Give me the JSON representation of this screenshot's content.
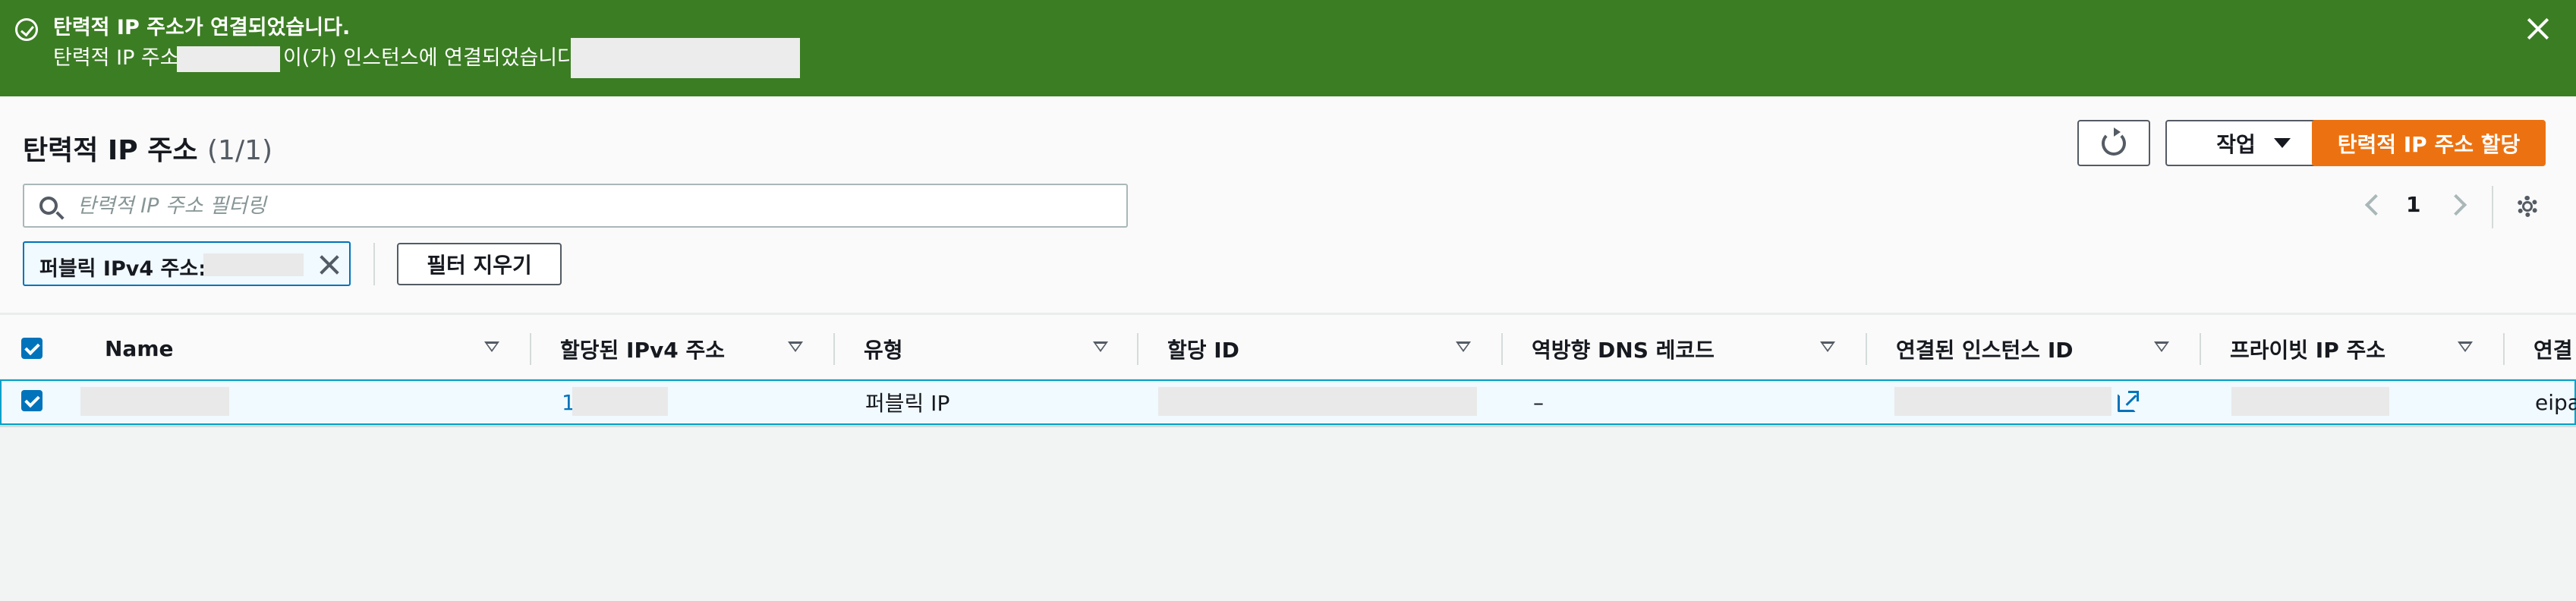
{
  "flash": {
    "title": "탄력적 IP 주소가 연결되었습니다.",
    "message_prefix": "탄력적 IP 주소",
    "message_middle": "이(가) 인스턴스에 연결되었습니다."
  },
  "header": {
    "title": "탄력적 IP 주소",
    "count": "(1/1)",
    "actions_label": "작업",
    "primary_label": "탄력적 IP 주소 할당"
  },
  "search": {
    "placeholder": "탄력적 IP 주소 필터링"
  },
  "pagination": {
    "current_page": "1"
  },
  "filter": {
    "token_label": "퍼블릭 IPv4 주소:",
    "clear_label": "필터 지우기"
  },
  "table": {
    "columns": [
      "Name",
      "할당된 IPv4 주소",
      "유형",
      "할당 ID",
      "역방향 DNS 레코드",
      "연결된 인스턴스 ID",
      "프라이빗 IP 주소",
      "연결"
    ],
    "rows": [
      {
        "ipv4_visible": "1",
        "type": "퍼블릭 IP",
        "reverse_dns": "–",
        "assoc_trunc": "eipas"
      }
    ]
  },
  "colors": {
    "success": "#3b7d23",
    "primary": "#ec7211",
    "link": "#0073bb"
  }
}
